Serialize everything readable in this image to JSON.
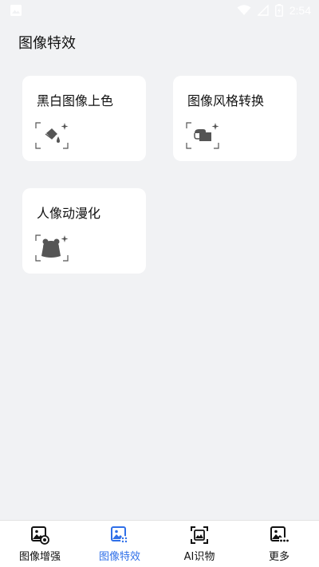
{
  "status_bar": {
    "time": "2:54",
    "icons": [
      "image-notification-icon",
      "wifi-icon",
      "signal-icon",
      "battery-icon"
    ]
  },
  "page": {
    "title": "图像特效"
  },
  "cards": [
    {
      "label": "黑白图像上色",
      "icon": "paint-bucket-icon"
    },
    {
      "label": "图像风格转换",
      "icon": "style-transfer-icon"
    },
    {
      "label": "人像动漫化",
      "icon": "bear-face-icon"
    }
  ],
  "bottom_nav": {
    "active_index": 1,
    "active_color": "#2f6fe8",
    "items": [
      {
        "label": "图像增强",
        "icon": "image-enhance-icon"
      },
      {
        "label": "图像特效",
        "icon": "image-effect-icon"
      },
      {
        "label": "AI识物",
        "icon": "ai-recognize-icon"
      },
      {
        "label": "更多",
        "icon": "more-icon"
      }
    ]
  }
}
